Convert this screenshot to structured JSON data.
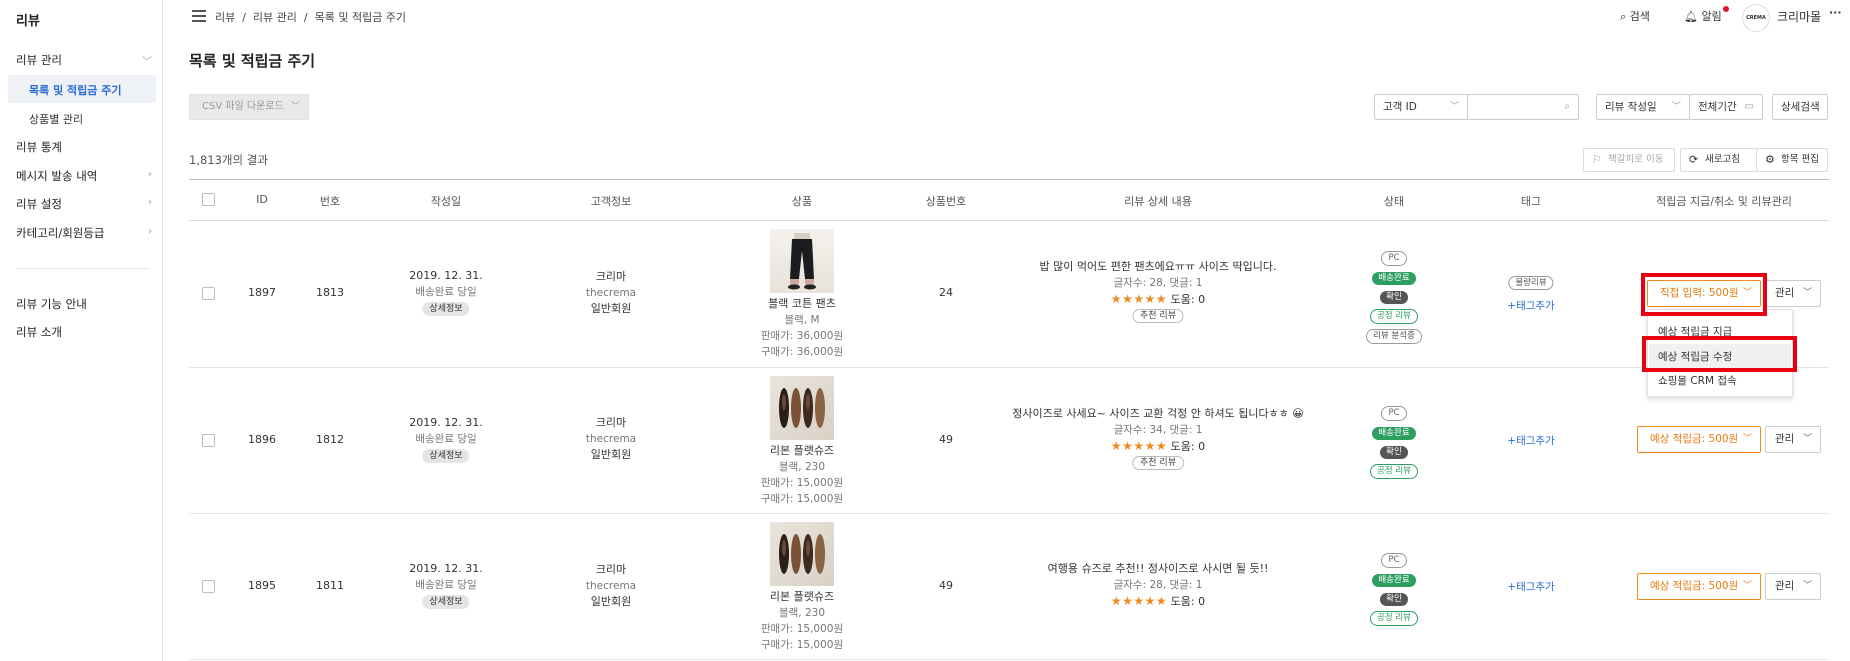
{
  "sidebar": {
    "title": "리뷰",
    "items": [
      {
        "label": "리뷰 관리",
        "chev": "﹀"
      },
      {
        "label": "목록 및 적립금 주기"
      },
      {
        "label": "상품별 관리"
      },
      {
        "label": "리뷰 통계"
      },
      {
        "label": "메시지 발송 내역",
        "chev": "›"
      },
      {
        "label": "리뷰 설정",
        "chev": "›"
      },
      {
        "label": "카테고리/회원등급",
        "chev": "›"
      },
      {
        "label": "리뷰 기능 안내"
      },
      {
        "label": "리뷰 소개"
      }
    ]
  },
  "header": {
    "breadcrumb": "리뷰  /  리뷰 관리  /  목록 및 적립금 주기",
    "search_label": "검색",
    "alert_label": "알림",
    "avatar_text": "CREMA",
    "user_name": "크리마몰",
    "more": "···"
  },
  "page": {
    "title": "목록 및 적립금 주기"
  },
  "toolbar": {
    "csv_label": "CSV 파일 다운로드",
    "customer_select": "고객 ID",
    "search_placeholder": "",
    "date_type": "리뷰 작성일",
    "period": "전체기간",
    "detail_search": "상세검색",
    "result_count": "1,813개의 결과",
    "bookmark": "책갈피로 이동",
    "refresh": "새로고침",
    "edit_columns": "항목 편집"
  },
  "table": {
    "headers": [
      "ID",
      "번호",
      "작성일",
      "고객정보",
      "상품",
      "상품번호",
      "리뷰 상세 내용",
      "상태",
      "태그",
      "적립금 지급/취소 및 리뷰관리"
    ],
    "rows": [
      {
        "id": "1897",
        "no": "1813",
        "date": "2019. 12. 31.",
        "date_sub": "배송완료 당일",
        "date_chip": "상세정보",
        "cust_name": "크리마",
        "cust_id": "thecrema",
        "cust_grade": "일반회원",
        "product_name": "블랙 코튼 팬츠",
        "product_opt": "블랙, M",
        "sale_price": "판매가: 36,000원",
        "buy_price": "구매가: 36,000원",
        "product_no": "24",
        "review": "밥 많이 먹어도 편한 팬츠에요ㅠㅠ 사이즈 딱입니다.",
        "review_meta": "글자수: 28, 댓글: 1",
        "stars": "★★★★★",
        "help": "도움: 0",
        "rec": "추천 리뷰",
        "status": [
          "PC",
          "배송완료",
          "확인",
          "공정 리뷰",
          "리뷰 분석중"
        ],
        "tag_chip": "불량리뷰",
        "tag_add": "+태그추가",
        "point_btn": "직접 입력: 500원",
        "manage": "관리"
      },
      {
        "id": "1896",
        "no": "1812",
        "date": "2019. 12. 31.",
        "date_sub": "배송완료 당일",
        "date_chip": "상세정보",
        "cust_name": "크리마",
        "cust_id": "thecrema",
        "cust_grade": "일반회원",
        "product_name": "리본 플랫슈즈",
        "product_opt": "블랙, 230",
        "sale_price": "판매가: 15,000원",
        "buy_price": "구매가: 15,000원",
        "product_no": "49",
        "review": "정사이즈로 사세요~ 사이즈 교환 걱정 안 하셔도 됩니다ㅎㅎ 😀",
        "review_meta": "글자수: 34, 댓글: 1",
        "stars": "★★★★★",
        "help": "도움: 0",
        "rec": "추천 리뷰",
        "status": [
          "PC",
          "배송완료",
          "확인",
          "공정 리뷰"
        ],
        "tag_add": "+태그추가",
        "point_btn": "예상 적립금: 500원",
        "manage": "관리"
      },
      {
        "id": "1895",
        "no": "1811",
        "date": "2019. 12. 31.",
        "date_sub": "배송완료 당일",
        "date_chip": "상세정보",
        "cust_name": "크리마",
        "cust_id": "thecrema",
        "cust_grade": "일반회원",
        "product_name": "리본 플랫슈즈",
        "product_opt": "블랙, 230",
        "sale_price": "판매가: 15,000원",
        "buy_price": "구매가: 15,000원",
        "product_no": "49",
        "review": "여행용 슈즈로 추천!! 정사이즈로 사시면 될 듯!!",
        "review_meta": "글자수: 28, 댓글: 1",
        "stars": "★★★★★",
        "help": "도움: 0",
        "status": [
          "PC",
          "배송완료",
          "확인",
          "공정 리뷰"
        ],
        "tag_add": "+태그추가",
        "point_btn": "예상 적립금: 500원",
        "manage": "관리"
      }
    ]
  },
  "dropdown": {
    "items": [
      "예상 적립금 지급",
      "예상 적립금 수정",
      "쇼핑몰 CRM 접속"
    ]
  },
  "colors": {
    "accent": "#2a6cd6",
    "orange": "#f08a1c",
    "highlight": "#e60012",
    "green": "#2e9e63"
  }
}
